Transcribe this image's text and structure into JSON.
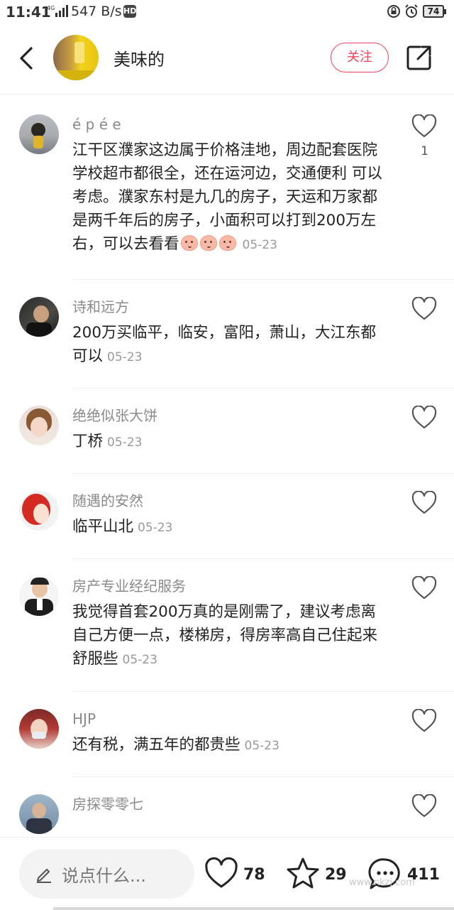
{
  "status_bar": {
    "time": "11:41",
    "network": "4G",
    "speed": "547 B/s",
    "hd": "HD",
    "battery": "74"
  },
  "header": {
    "title": "美味的",
    "follow_label": "关注",
    "icons": [
      "back-chevron-icon",
      "share-icon"
    ]
  },
  "comments": [
    {
      "user": "é p é e",
      "text": "江干区濮家这边属于价格洼地，周边配套医院学校超市都很全，还在运河边，交通便利 可以考虑。濮家东村是九几的房子，天运和万家都是两千年后的房子，小面积可以打到200万左右，可以去看看",
      "emoji_count": 3,
      "date": "05-23",
      "likes": "1"
    },
    {
      "user": "诗和远方",
      "text": "200万买临平，临安，富阳，萧山，大江东都可以",
      "date": "05-23",
      "likes": ""
    },
    {
      "user": "绝绝似张大饼",
      "text": "丁桥",
      "date": "05-23",
      "likes": ""
    },
    {
      "user": "随遇的安然",
      "text": "临平山北",
      "date": "05-23",
      "likes": ""
    },
    {
      "user": "房产专业经纪服务",
      "text": "我觉得首套200万真的是刚需了，建议考虑离自己方便一点，楼梯房，得房率高自己住起来舒服些",
      "date": "05-23",
      "likes": ""
    },
    {
      "user": "HJP",
      "text": "还有税，满五年的都贵些",
      "date": "05-23",
      "likes": ""
    },
    {
      "user": "房探零零七",
      "text": "",
      "date": "",
      "likes": ""
    }
  ],
  "bottom_bar": {
    "input_placeholder": "说点什么...",
    "likes": "78",
    "stars": "29",
    "comments": "411",
    "watermark": "www.nkzj.com"
  },
  "colors": {
    "accent": "#f0435a",
    "name_gray": "#8a8a8a",
    "date_gray": "#9a9a9a",
    "divider": "#ececec"
  }
}
